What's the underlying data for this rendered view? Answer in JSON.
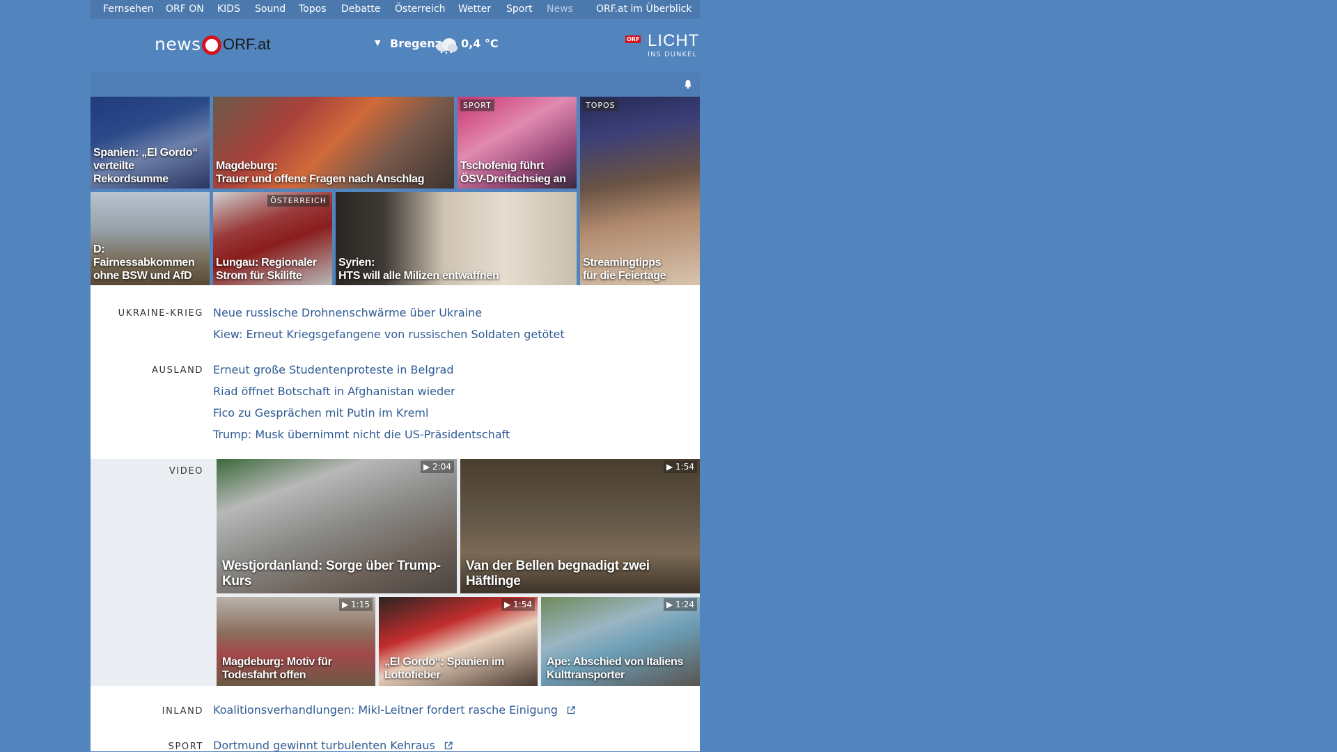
{
  "topnav": {
    "items": [
      "Fernsehen",
      "ORF ON",
      "KIDS",
      "Sound",
      "Topos",
      "Debatte",
      "Österreich",
      "Wetter",
      "Sport",
      "News",
      "ORF.at im Überblick"
    ]
  },
  "header": {
    "logo_news": "news",
    "logo_orf": "ORF.at",
    "weather_city": "Bregenz",
    "weather_temp": "0,4 °C",
    "licht_badge": "ORF",
    "licht_big": "LICHT",
    "licht_small": "INS DUNKEL"
  },
  "tiles": {
    "t1": {
      "line1": "Spanien: „El Gordo“",
      "line2": "verteilte Rekordsumme"
    },
    "t2": {
      "line1": "Magdeburg:",
      "line2": "Trauer und offene Fragen nach Anschlag"
    },
    "t3": {
      "label": "SPORT",
      "line1": "Tschofenig führt",
      "line2": "ÖSV-Dreifachsieg an"
    },
    "t4": {
      "label": "TOPOS",
      "line1": "Streamingtipps",
      "line2": "für die Feiertage"
    },
    "t5": {
      "line1": "D: Fairnessabkommen",
      "line2": "ohne BSW und AfD"
    },
    "t6": {
      "label": "ÖSTERREICH",
      "line1": "Lungau: Regionaler",
      "line2": "Strom für Skilifte"
    },
    "t7": {
      "line1": "Syrien:",
      "line2": "HTS will alle Milizen entwaffnen"
    }
  },
  "sections": {
    "ukraine": {
      "label": "UKRAINE-KRIEG",
      "stories": [
        "Neue russische Drohnenschwärme über Ukraine",
        "Kiew: Erneut Kriegsgefangene von russischen Soldaten getötet"
      ]
    },
    "ausland": {
      "label": "AUSLAND",
      "stories": [
        "Erneut große Studentenproteste in Belgrad",
        "Riad öffnet Botschaft in Afghanistan wieder",
        "Fico zu Gesprächen mit Putin im Kreml",
        "Trump: Musk übernimmt nicht die US-Präsidentschaft"
      ]
    },
    "video": {
      "label": "VIDEO"
    },
    "inland": {
      "label": "INLAND",
      "stories": [
        "Koalitionsverhandlungen: Mikl-Leitner fordert rasche Einigung"
      ]
    },
    "sport": {
      "label": "SPORT",
      "stories": [
        "Dortmund gewinnt turbulenten Kehraus"
      ]
    }
  },
  "videos": {
    "v1": {
      "title": "Westjordanland: Sorge über Trump-Kurs",
      "duration": "2:04"
    },
    "v2": {
      "title": "Van der Bellen begnadigt zwei Häftlinge",
      "duration": "1:54"
    },
    "v3": {
      "line1": "Magdeburg: Motiv für",
      "line2": "Todesfahrt offen",
      "duration": "1:15"
    },
    "v4": {
      "line1": "„El Gordo“: Spanien im",
      "line2": "Lottofieber",
      "duration": "1:54"
    },
    "v5": {
      "line1": "Ape: Abschied von Italiens",
      "line2": "Kulttransporter",
      "duration": "1:24"
    }
  },
  "colors": {
    "background": "#5284bd",
    "link": "#2f5b94",
    "orf_red": "#d4131e"
  },
  "icons": [
    "dropdown-arrow-icon",
    "cloud-snow-icon",
    "bell-icon",
    "play-icon",
    "external-link-icon"
  ]
}
